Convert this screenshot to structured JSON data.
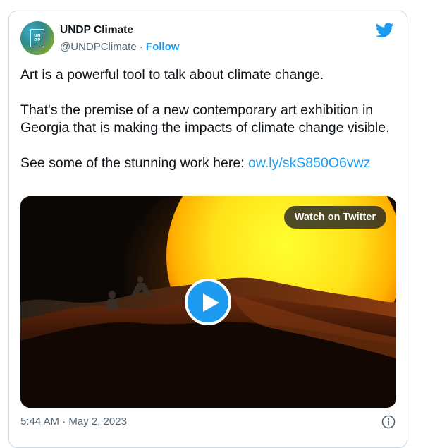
{
  "tweet": {
    "author": {
      "name": "UNDP Climate",
      "handle": "@UNDPClimate",
      "separator": " · ",
      "follow_label": "Follow",
      "avatar_logo_lines": [
        "UN",
        "DP"
      ]
    },
    "text": {
      "line1": "Art is a powerful tool to talk about climate change.",
      "line2": "That's the premise of a new contemporary art exhibition in Georgia that is making the impacts of climate change visible.",
      "line3_prefix": "See some of the stunning work here: ",
      "link": "ow.ly/skS850O6vwz"
    },
    "media": {
      "watch_label": "Watch on Twitter",
      "play_icon": "play-icon"
    },
    "timestamp": "5:44 AM · May 2, 2023",
    "icons": {
      "brand": "twitter-bird-icon",
      "info": "info-icon"
    },
    "colors": {
      "accent": "#1d9bf0",
      "muted_text": "#536471",
      "border": "#cfd9de"
    }
  }
}
